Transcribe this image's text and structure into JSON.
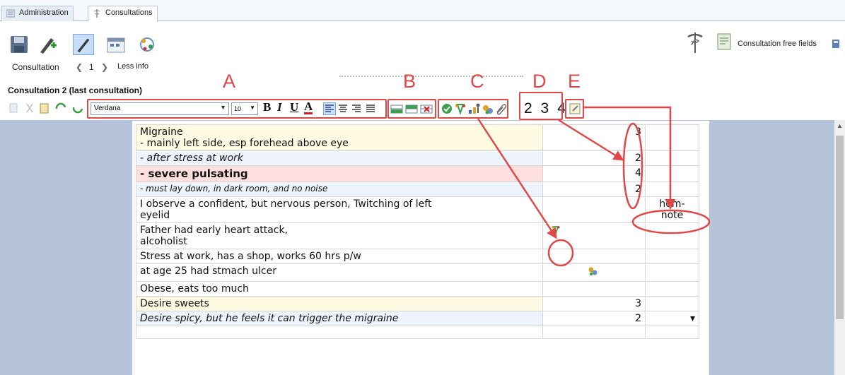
{
  "tabs": [
    {
      "label": "Administration",
      "active": false
    },
    {
      "label": "Consultations",
      "active": true
    }
  ],
  "toolbar": {
    "right_label": "Consultation free fields"
  },
  "nav": {
    "label": "Consultation",
    "number": "1",
    "less_info": "Less info"
  },
  "consultation_title": "Consultation 2 (last consultation)",
  "format": {
    "font": "Verdana",
    "size": "10",
    "bold": "B",
    "italic": "I",
    "underline": "U",
    "color": "A"
  },
  "levels": [
    "2",
    "3",
    "4"
  ],
  "annotations": {
    "A": "A",
    "B": "B",
    "C": "C",
    "D": "D",
    "E": "E"
  },
  "rows": [
    {
      "text": "Migraine",
      "text2": "- mainly left side, esp forehead above eye",
      "value": "3",
      "note": "",
      "style": "yellow"
    },
    {
      "text": "- after stress at work",
      "text2": "",
      "value": "2",
      "note": "",
      "style": "blue italic"
    },
    {
      "text": "- severe pulsating",
      "text2": "",
      "value": "4",
      "note": "",
      "style": "pink bold"
    },
    {
      "text": "- must lay down, in dark room, and no noise",
      "text2": "",
      "value": "2",
      "note": "",
      "style": "blue italic small"
    },
    {
      "text": "I observe a confident, but nervous person, Twitching of left",
      "text2": "eyelid",
      "value": "",
      "note": "hom-note",
      "style": ""
    },
    {
      "text": "Father had early heart attack,",
      "text2": "alcoholist",
      "value": "",
      "note": "",
      "style": "",
      "icon": "miasm-icon"
    },
    {
      "text": "Stress at work, has a shop, works 60 hrs p/w",
      "text2": "",
      "value": "",
      "note": "",
      "style": ""
    },
    {
      "text": "at age 25 had stmach ulcer",
      "text2": "",
      "value": "",
      "note": "",
      "style": "",
      "icon": "remedy-icon"
    },
    {
      "text": "Obese, eats too much",
      "text2": "",
      "value": "",
      "note": "",
      "style": ""
    },
    {
      "text": "Desire sweets",
      "text2": "",
      "value": "3",
      "note": "",
      "style": "yellow"
    },
    {
      "text": "Desire spicy, but he feels it can trigger the migraine",
      "text2": "",
      "value": "2",
      "note": "",
      "style": "blue italic"
    },
    {
      "text": "",
      "text2": "",
      "value": "",
      "note": "",
      "style": ""
    }
  ],
  "dropdown_glyph": "▾",
  "colors": {
    "annotation": "#e04848",
    "content_bg": "#b5c3db",
    "yellow_row": "#fffbe2",
    "blue_row": "#eef4fd",
    "pink_row": "#fde0de"
  }
}
